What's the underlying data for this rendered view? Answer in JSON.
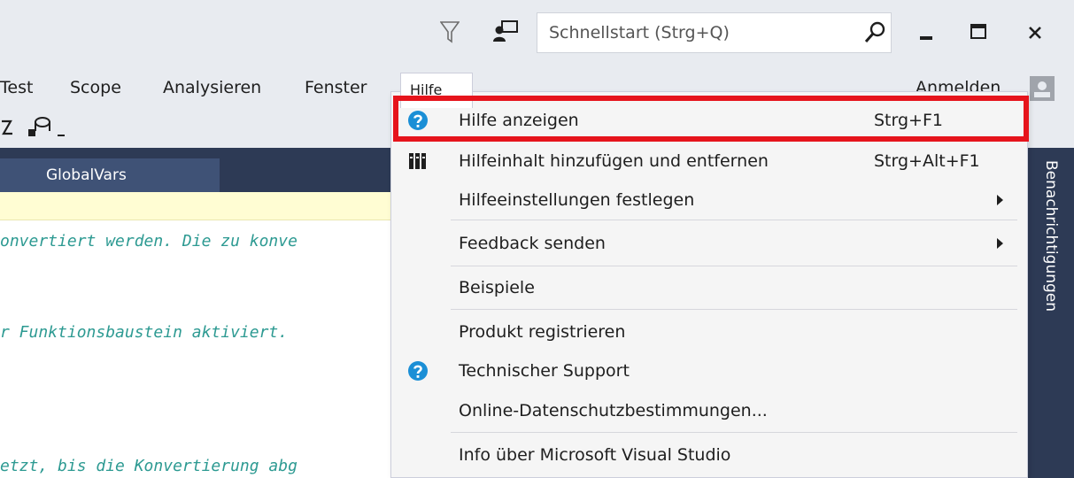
{
  "titlebar": {
    "search": {
      "placeholder": "Schnellstart (Strg+Q)"
    },
    "icons": [
      "filter-icon",
      "feedback-icon",
      "search-icon",
      "minimize-icon",
      "maximize-icon",
      "close-icon"
    ]
  },
  "menubar": {
    "items": [
      {
        "label": "Test"
      },
      {
        "label": "Scope"
      },
      {
        "label": "Analysieren"
      },
      {
        "label": "Fenster"
      },
      {
        "label": "Hilfe"
      }
    ],
    "sign_in": "Anmelden"
  },
  "tabs": {
    "active": "GlobalVars"
  },
  "editor": {
    "lines": [
      "onvertiert werden. Die zu konve",
      "r Funktionsbaustein aktiviert.",
      "etzt, bis die Konvertierung abg"
    ]
  },
  "rail": {
    "label": "Benachrichtigungen"
  },
  "help_menu": {
    "items": [
      {
        "label": "Hilfe anzeigen",
        "shortcut": "Strg+F1",
        "icon": "help-circle-icon"
      },
      {
        "label": "Hilfeinhalt hinzufügen und entfernen",
        "shortcut": "Strg+Alt+F1",
        "icon": "library-icon"
      },
      {
        "label": "Hilfeeinstellungen festlegen",
        "submenu": true
      },
      {
        "label": "Feedback senden",
        "submenu": true
      },
      {
        "label": "Beispiele"
      },
      {
        "label": "Produkt registrieren"
      },
      {
        "label": "Technischer Support",
        "icon": "help-circle-icon"
      },
      {
        "label": "Online-Datenschutzbestimmungen..."
      },
      {
        "label": "Info über Microsoft Visual Studio"
      }
    ],
    "highlighted": "Hilfe anzeigen"
  },
  "colors": {
    "chrome": "#e8ebf0",
    "dark_panel": "#2d3a55",
    "active_tab": "#3f5276",
    "comment_text": "#2d9a92",
    "info_bar": "#fffdd3",
    "highlight_border": "#e6141c",
    "help_icon": "#1b8fd6"
  }
}
